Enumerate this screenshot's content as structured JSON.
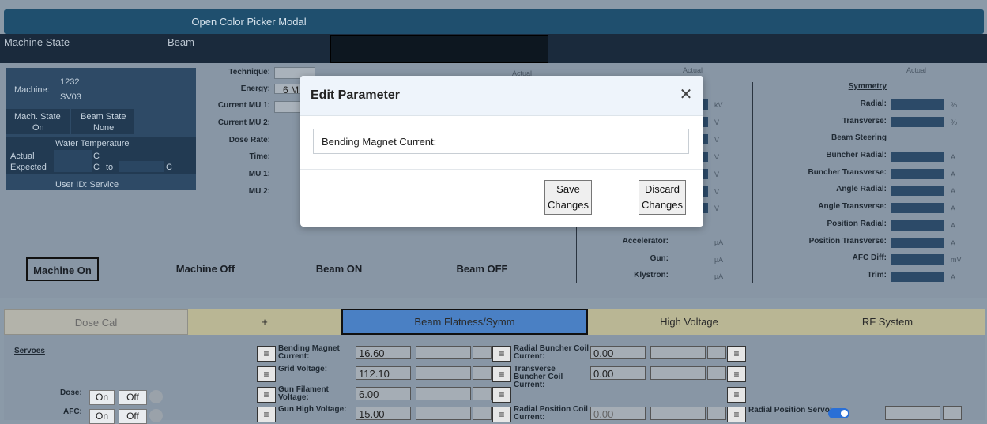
{
  "topbar": {
    "open_color_picker": "Open Color Picker Modal"
  },
  "nav": {
    "machine_state": "Machine State",
    "beam": "Beam"
  },
  "machine": {
    "machine_label": "Machine:",
    "machine_id": "1232",
    "machine_sv": "SV03",
    "mach_state_label": "Mach. State",
    "mach_state_value": "On",
    "beam_state_label": "Beam State",
    "beam_state_value": "None",
    "water_temp_title": "Water Temperature",
    "actual_label": "Actual",
    "expected_label": "Expected",
    "unit_c": "C",
    "to_label": "to",
    "user_id": "User ID: Service"
  },
  "treatment": {
    "technique": "Technique:",
    "energy": "Energy:",
    "energy_value": "6 M",
    "current_mu1": "Current MU 1:",
    "current_mu2": "Current MU 2:",
    "dose_rate": "Dose Rate:",
    "time": "Time:",
    "mu1": "MU 1:",
    "mu2": "MU 2:",
    "actual_header": "Actual"
  },
  "units_column": {
    "actual_header": "Actual",
    "units": [
      "kV",
      "V",
      "V",
      "V",
      "V",
      "V",
      "V"
    ]
  },
  "currents": {
    "accelerator": "Accelerator:",
    "gun": "Gun:",
    "klystron": "Klystron:",
    "unit": "µA"
  },
  "symmetry": {
    "actual_header": "Actual",
    "symmetry_title": "Symmetry",
    "radial": "Radial:",
    "transverse": "Transverse:",
    "percent": "%",
    "beam_steering_title": "Beam Steering",
    "rows": [
      {
        "label": "Buncher Radial:",
        "unit": "A"
      },
      {
        "label": "Buncher Transverse:",
        "unit": "A"
      },
      {
        "label": "Angle Radial:",
        "unit": "A"
      },
      {
        "label": "Angle Transverse:",
        "unit": "A"
      },
      {
        "label": "Position Radial:",
        "unit": "A"
      },
      {
        "label": "Position Transverse:",
        "unit": "A"
      },
      {
        "label": "AFC Diff:",
        "unit": "mV"
      },
      {
        "label": "Trim:",
        "unit": "A"
      }
    ]
  },
  "controls": {
    "machine_on": "Machine On",
    "machine_off": "Machine Off",
    "beam_on": "Beam ON",
    "beam_off": "Beam OFF"
  },
  "modal": {
    "title": "Edit Parameter",
    "field_value": "Bending Magnet Current:",
    "save": "Save Changes",
    "discard": "Discard Changes"
  },
  "tabs": [
    {
      "label": "Dose Cal"
    },
    {
      "label": "+"
    },
    {
      "label": "Beam Flatness/Symm",
      "active": true
    },
    {
      "label": "High Voltage"
    },
    {
      "label": "RF System"
    }
  ],
  "lower": {
    "servoes": "Servoes",
    "dose": "Dose:",
    "afc": "AFC:",
    "on": "On",
    "off": "Off",
    "menu_glyph": "≡",
    "left_params": [
      {
        "label": "Bending Magnet Current:",
        "value": "16.60"
      },
      {
        "label": "Grid Voltage:",
        "value": "112.10"
      },
      {
        "label": "Gun Filament Voltage:",
        "value": "6.00"
      },
      {
        "label": "Gun High Voltage:",
        "value": "15.00"
      }
    ],
    "right_params": [
      {
        "label": "Radial Buncher Coil Current:",
        "value": "0.00"
      },
      {
        "label": "Transverse Buncher Coil Current:",
        "value": "0.00"
      },
      {
        "label": "",
        "value": ""
      },
      {
        "label": "Radial Position Coil Current:",
        "value": "0.00"
      }
    ],
    "radial_position_servo": "Radial Position Servo:"
  },
  "colors": {
    "accent": "#4a80c4",
    "topbar": "#1f4f6e",
    "nav": "#1a2a3c"
  }
}
